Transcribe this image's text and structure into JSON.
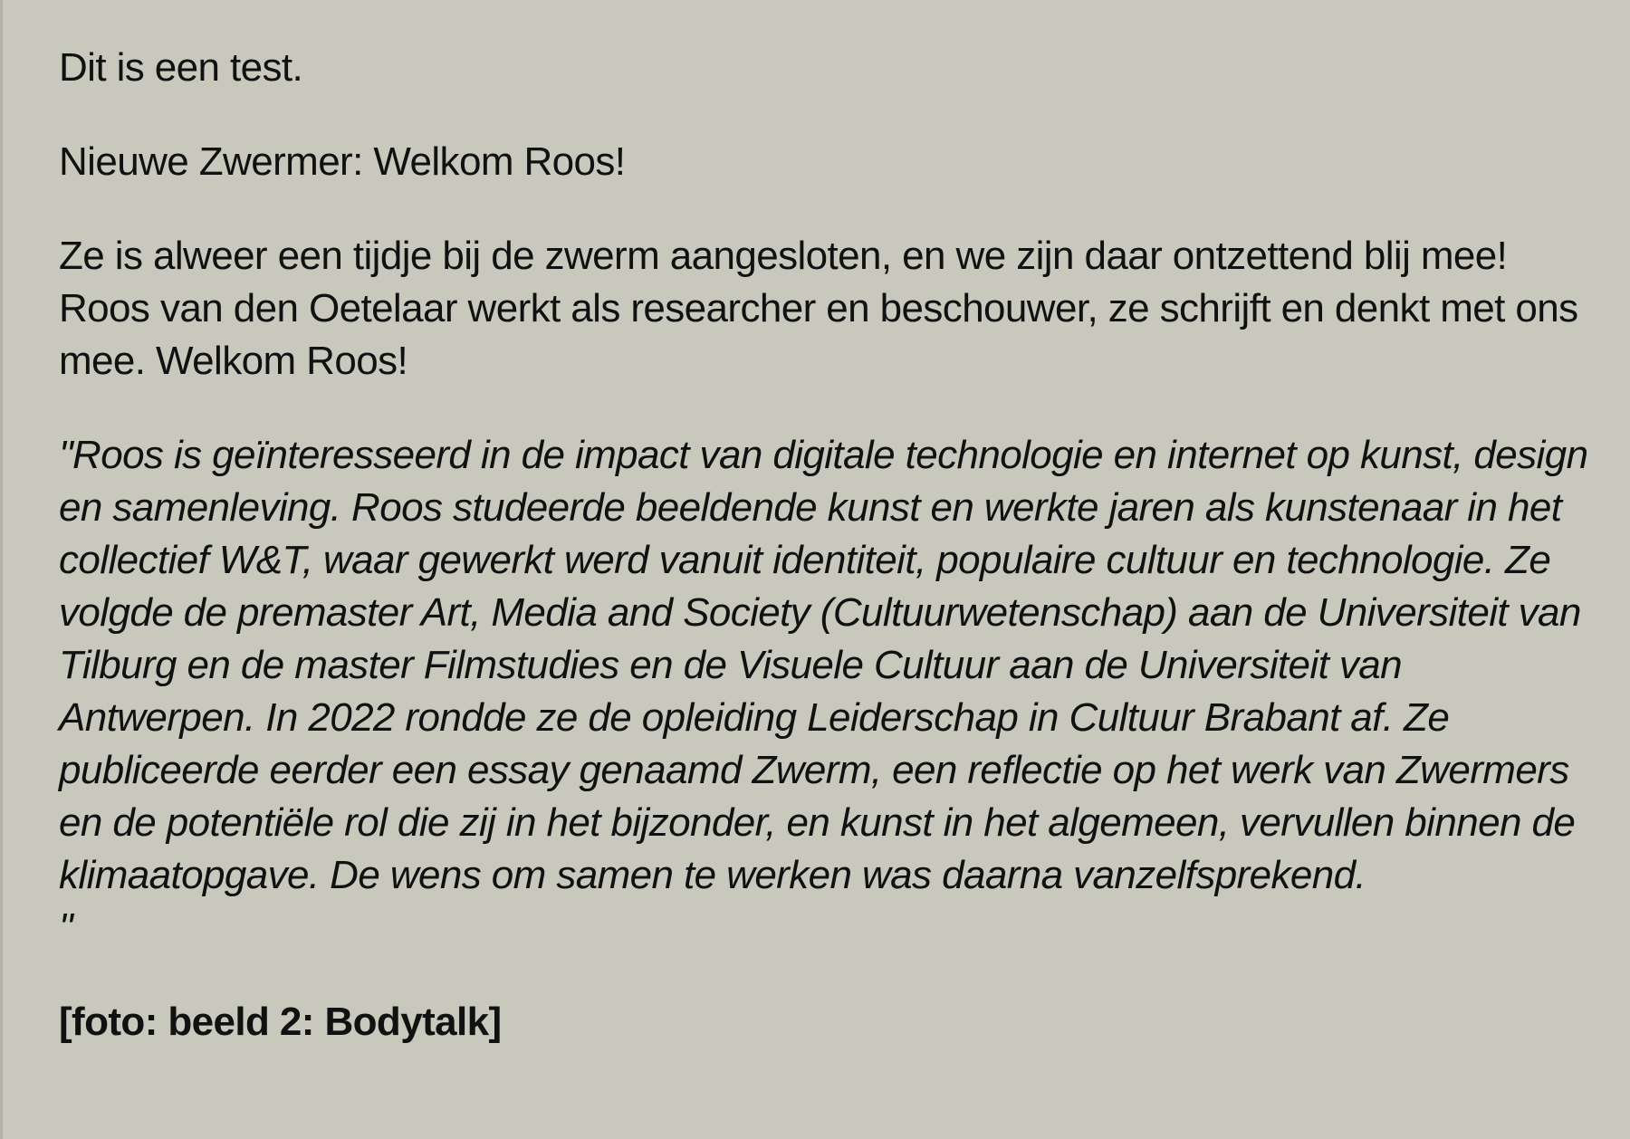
{
  "article": {
    "line1": "Dit is een test.",
    "heading": "Nieuwe Zwermer: Welkom Roos!",
    "intro": "Ze is alweer een tijdje bij de zwerm aangesloten, en we zijn daar ontzettend blij mee! Roos van den Oetelaar werkt als researcher en beschouwer, ze schrijft en denkt met ons mee. Welkom Roos!",
    "quote": "\"Roos is geïnteresseerd in de impact van digitale technologie en internet op kunst, design en samenleving. Roos studeerde beeldende kunst en werkte jaren als kunstenaar in het collectief W&T, waar gewerkt werd vanuit identiteit, populaire cultuur en technologie. Ze volgde de premaster Art, Media and Society (Cultuurwetenschap) aan de Universiteit van Tilburg en de master Filmstudies en de Visuele Cultuur aan de Universiteit van Antwerpen. In 2022 rondde ze de opleiding Leiderschap in Cultuur Brabant af. Ze publiceerde eerder een essay genaamd Zwerm, een reflectie op het werk van Zwermers en de potentiële rol die zij in het bijzonder, en kunst in het algemeen, vervullen binnen de klimaatopgave. De wens om samen te werken was daarna vanzelfsprekend.",
    "quote_close": "\"",
    "caption": "[foto: beeld 2: Bodytalk]"
  }
}
